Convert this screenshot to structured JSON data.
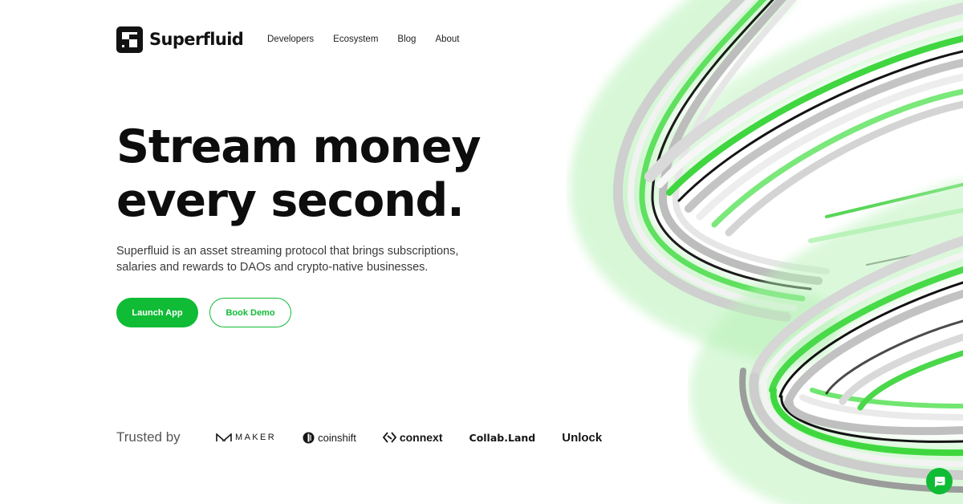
{
  "colors": {
    "accent": "#10bb35",
    "text": "#0d0d0d",
    "muted": "#555555"
  },
  "header": {
    "logo_text": "Superfluid",
    "logo_icon": "superfluid-square-icon",
    "nav": [
      "Developers",
      "Ecosystem",
      "Blog",
      "About"
    ]
  },
  "hero": {
    "title_line1": "Stream money",
    "title_line2": "every second.",
    "subtitle_line1": "Superfluid is an asset streaming protocol that brings subscriptions,",
    "subtitle_line2": "salaries and rewards to DAOs and crypto-native businesses.",
    "primary_cta": "Launch App",
    "secondary_cta": "Book Demo"
  },
  "trusted": {
    "label": "Trusted by",
    "brands": [
      "MAKER",
      "coinshift",
      "connext",
      "Collab.Land",
      "Unlock"
    ]
  },
  "chat": {
    "icon": "chat-bubble-icon"
  }
}
